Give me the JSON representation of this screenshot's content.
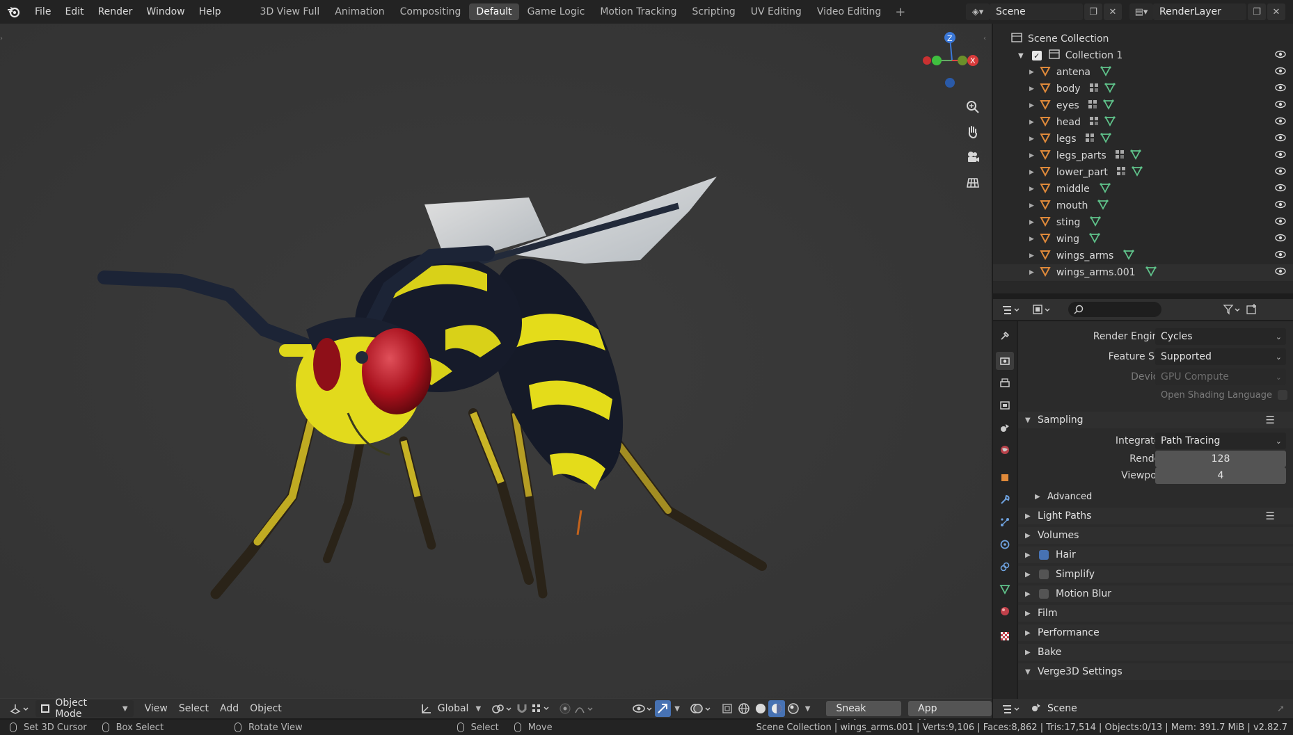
{
  "topbar": {
    "menus": [
      "File",
      "Edit",
      "Render",
      "Window",
      "Help"
    ],
    "workspaces": [
      "3D View Full",
      "Animation",
      "Compositing",
      "Default",
      "Game Logic",
      "Motion Tracking",
      "Scripting",
      "UV Editing",
      "Video Editing"
    ],
    "active_workspace": "Default",
    "add_tab": "+",
    "scene_name": "Scene",
    "view_layer_name": "RenderLayer"
  },
  "viewport": {
    "gizmo": {
      "z": "Z",
      "x": "X"
    },
    "header": {
      "mode": "Object Mode",
      "menus": [
        "View",
        "Select",
        "Add",
        "Object"
      ],
      "transform_orientation": "Global",
      "sneak_peek": "Sneak Peek",
      "app_manager": "App Manager"
    }
  },
  "outliner": {
    "root": "Scene Collection",
    "collection": "Collection 1",
    "objects": [
      {
        "name": "antena",
        "modifier": false
      },
      {
        "name": "body",
        "modifier": true
      },
      {
        "name": "eyes",
        "modifier": true
      },
      {
        "name": "head",
        "modifier": true
      },
      {
        "name": "legs",
        "modifier": true
      },
      {
        "name": "legs_parts",
        "modifier": true
      },
      {
        "name": "lower_part",
        "modifier": true
      },
      {
        "name": "middle",
        "modifier": false
      },
      {
        "name": "mouth",
        "modifier": false
      },
      {
        "name": "sting",
        "modifier": false
      },
      {
        "name": "wing",
        "modifier": false
      },
      {
        "name": "wings_arms",
        "modifier": false
      },
      {
        "name": "wings_arms.001",
        "modifier": false
      }
    ]
  },
  "properties": {
    "search_placeholder": "",
    "render_engine_label": "Render Engine",
    "render_engine": "Cycles",
    "feature_set_label": "Feature Set",
    "feature_set": "Supported",
    "device_label": "Device",
    "device": "GPU Compute",
    "osl_label": "Open Shading Language",
    "sampling": "Sampling",
    "integrator_label": "Integrator",
    "integrator": "Path Tracing",
    "render_label": "Render",
    "render_samples": "128",
    "viewport_label": "Viewport",
    "viewport_samples": "4",
    "advanced": "Advanced",
    "light_paths": "Light Paths",
    "volumes": "Volumes",
    "hair": "Hair",
    "simplify": "Simplify",
    "motion_blur": "Motion Blur",
    "film": "Film",
    "performance": "Performance",
    "bake": "Bake",
    "verge3d": "Verge3D Settings",
    "footer_scene": "Scene"
  },
  "statusbar": {
    "set_cursor": "Set 3D Cursor",
    "box_select": "Box Select",
    "rotate_view": "Rotate View",
    "select": "Select",
    "move": "Move",
    "stats": "Scene Collection | wings_arms.001 | Verts:9,106 | Faces:8,862 | Tris:17,514 | Objects:0/13 | Mem: 391.7 MiB | v2.82.7"
  },
  "colors": {
    "accent": "#4772b3",
    "object_orange": "#e08a3a",
    "mesh_green": "#5fc28a",
    "wasp_yellow": "#e6dc1a",
    "wasp_black": "#1a1f2e",
    "eye_red": "#b3121a"
  }
}
